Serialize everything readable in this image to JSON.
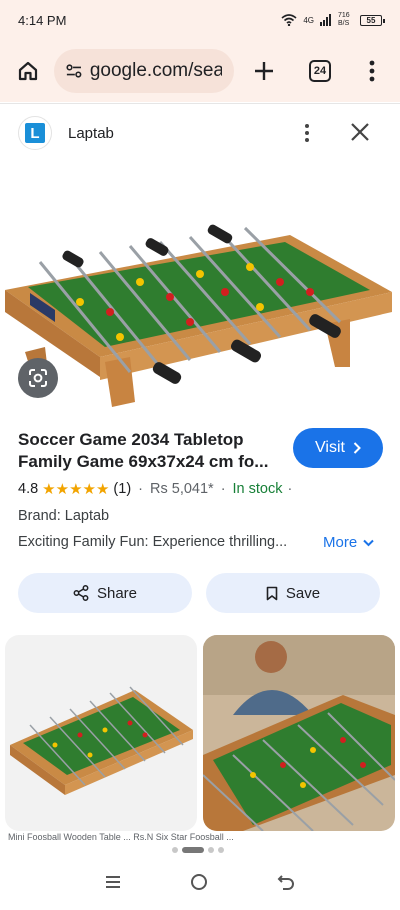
{
  "status": {
    "time": "4:14 PM",
    "network": "4G",
    "speed": "716 B/S",
    "battery": "55"
  },
  "browser": {
    "url": "google.com/searc",
    "tab_count": "24"
  },
  "sheet": {
    "brand_name": "Laptab",
    "brand_logo_letter": "L",
    "title_line1": "Soccer Game 2034 Tabletop",
    "title_line2": "Family Game 69x37x24 cm fo...",
    "visit_label": "Visit",
    "rating": "4.8",
    "stars": "★★★★★",
    "reviews": "(1)",
    "sep1": "·",
    "price": "Rs 5,041*",
    "sep2": "·",
    "stock": "In stock",
    "sep3": "·",
    "brand_line": "Brand: Laptab",
    "description": "Exciting Family Fun: Experience thrilling...",
    "more_label": "More",
    "share_label": "Share",
    "save_label": "Save",
    "caption_text": "Mini Foosball Wooden Table ...   Rs.N Six Star Foosball ..."
  },
  "colors": {
    "accent": "#1a73e8",
    "stock": "#188038",
    "star": "#f2a400",
    "pill_bg": "#e8effc",
    "chrome_bg": "#fdf0ea"
  }
}
